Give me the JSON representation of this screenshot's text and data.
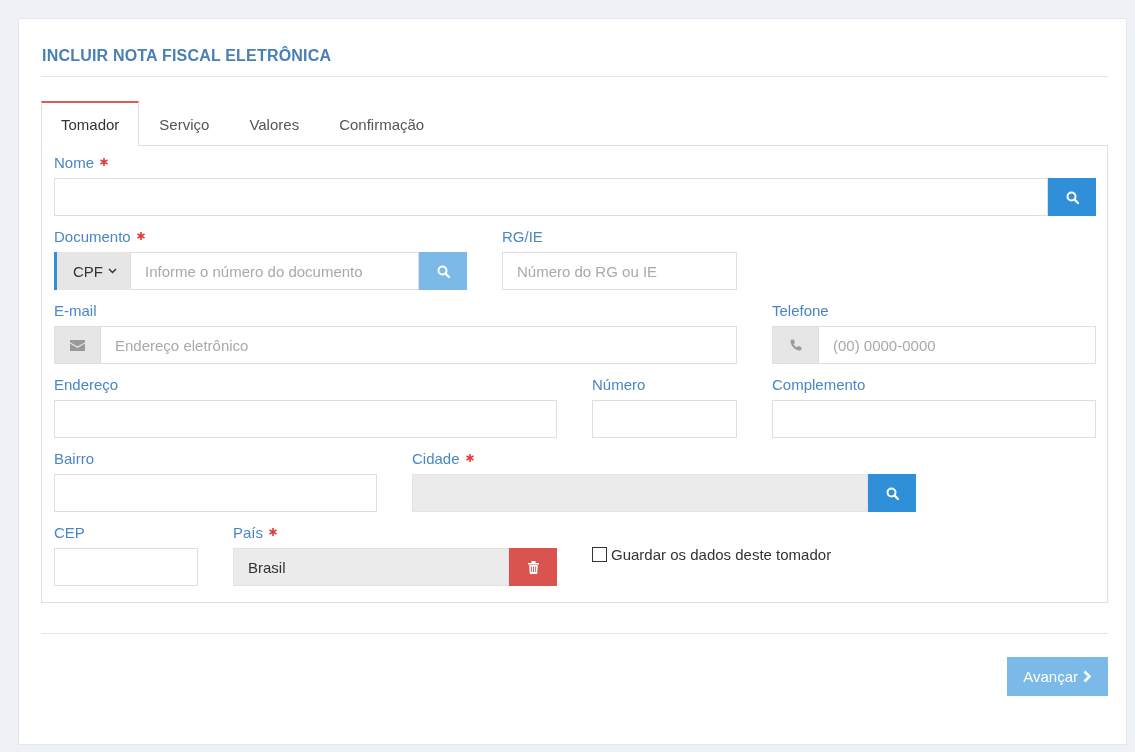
{
  "title": "INCLUIR NOTA FISCAL ELETRÔNICA",
  "tabs": [
    {
      "label": "Tomador",
      "selected": true
    },
    {
      "label": "Serviço",
      "selected": false
    },
    {
      "label": "Valores",
      "selected": false
    },
    {
      "label": "Confirmação",
      "selected": false
    }
  ],
  "form_rows": [
    [
      {
        "kind": "search",
        "label": "Nome",
        "required": true,
        "search_disabled": false
      }
    ],
    [
      {
        "kind": "document",
        "label": "Documento",
        "required": true,
        "document_type": "CPF",
        "placeholder": "Informe o número do documento",
        "search_disabled": true
      },
      {
        "kind": "text",
        "label": "RG/IE",
        "required": false,
        "placeholder": "Número do RG ou IE"
      }
    ],
    [
      {
        "kind": "email",
        "label": "E-mail",
        "required": false,
        "placeholder": "Endereço eletrônico"
      },
      {
        "kind": "phone",
        "label": "Telefone",
        "required": false,
        "placeholder": "(00) 0000-0000"
      }
    ],
    [
      {
        "kind": "text",
        "label": "Endereço",
        "required": false
      },
      {
        "kind": "text",
        "label": "Número",
        "required": false
      },
      {
        "kind": "text",
        "label": "Complemento",
        "required": false
      }
    ],
    [
      {
        "kind": "text",
        "label": "Bairro",
        "required": false
      },
      {
        "kind": "lookup",
        "label": "Cidade",
        "required": true,
        "readonly": true,
        "search_disabled": false
      }
    ],
    [
      {
        "kind": "text",
        "label": "CEP",
        "required": false
      },
      {
        "kind": "clearable",
        "label": "País",
        "required": true,
        "readonly": true,
        "value": "Brasil"
      },
      {
        "kind": "checkbox",
        "label": "Guardar os dados deste tomador",
        "checked": false
      }
    ]
  ],
  "next_button": {
    "label": "Avançar",
    "disabled": true
  }
}
